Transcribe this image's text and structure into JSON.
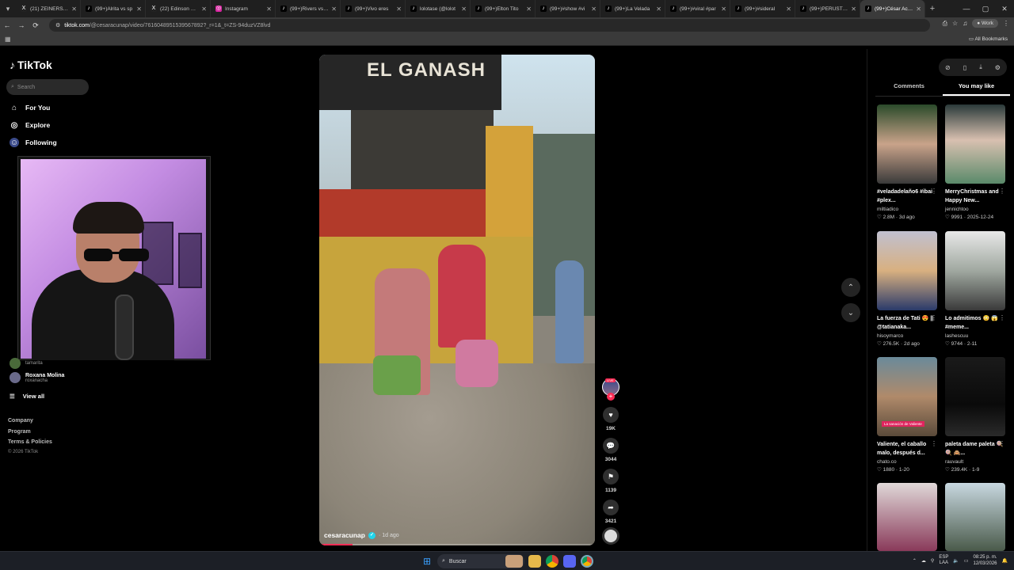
{
  "browser": {
    "tabs": [
      {
        "title": "(21) ZEINERS 😮",
        "icon": "x-icon",
        "color": "#222"
      },
      {
        "title": "(99+)Alrita vs sp",
        "icon": "tiktok-icon",
        "color": "#000"
      },
      {
        "title": "(22) Edinson Cav",
        "icon": "x-icon",
        "color": "#222"
      },
      {
        "title": "Instagram",
        "icon": "instagram-icon",
        "color": "#d6249f"
      },
      {
        "title": "(99+)Rivers vs Re",
        "icon": "tiktok-icon",
        "color": "#000"
      },
      {
        "title": "(99+)Vivo eres",
        "icon": "tiktok-icon",
        "color": "#000"
      },
      {
        "title": "lolotase (@lolot",
        "icon": "tiktok-icon",
        "color": "#000"
      },
      {
        "title": "(99+)Elton Tito",
        "icon": "tiktok-icon",
        "color": "#000"
      },
      {
        "title": "(99+)#show #vi",
        "icon": "tiktok-icon",
        "color": "#000"
      },
      {
        "title": "(99+)La Velada",
        "icon": "tiktok-icon",
        "color": "#000"
      },
      {
        "title": "(99+)#viral #par",
        "icon": "tiktok-icon",
        "color": "#000"
      },
      {
        "title": "(99+)#sideral",
        "icon": "tiktok-icon",
        "color": "#000"
      },
      {
        "title": "(99+)PERUST CO",
        "icon": "tiktok-icon",
        "color": "#000"
      },
      {
        "title": "(99+)César Acuña",
        "icon": "tiktok-icon",
        "color": "#000",
        "active": true
      }
    ],
    "url_host": "tiktok.com",
    "url_path": "/@cesaracunap/video/7616048951539567892?_r=1&_t=ZS-94duzVZ8lvd",
    "profile_label": "Work",
    "all_bookmarks": "All Bookmarks"
  },
  "sidebar": {
    "brand": "TikTok",
    "search_placeholder": "Search",
    "nav": [
      {
        "label": "For You",
        "icon": "home-icon"
      },
      {
        "label": "Explore",
        "icon": "compass-icon"
      },
      {
        "label": "Following",
        "icon": "following-icon"
      }
    ],
    "partial_label": "tamarita",
    "account": {
      "name": "Roxana Molina",
      "handle": "roxanacha"
    },
    "view_all": "View all",
    "footer": [
      "Company",
      "Program",
      "Terms & Policies"
    ],
    "copyright": "© 2026 TikTok"
  },
  "video": {
    "sign_text": "EL GANASH",
    "username": "cesaracunap",
    "time_ago": "· 1d ago",
    "progress": 0.12
  },
  "actions": {
    "live_badge": "LIVE",
    "likes": "19K",
    "comments": "3044",
    "saves": "1139",
    "shares": "3421"
  },
  "right_panel": {
    "tabs": [
      "Comments",
      "You may like"
    ],
    "active_tab": "You may like",
    "cards": [
      {
        "caption": "#veladadelaño6 #ibai #plex...",
        "author": "miltiadico",
        "likes": "2.8M",
        "date": "3d ago"
      },
      {
        "caption": "MerryChristmas and Happy New...",
        "author": "jennichtoo",
        "likes": "9991",
        "date": "2025-12-24"
      },
      {
        "caption": "La fuerza de Tati 😍 || @tatianaka...",
        "author": "hisoymarco",
        "likes": "276.5K",
        "date": "2d ago"
      },
      {
        "caption": "Lo admitimos 😳 😱 #meme...",
        "author": "lashescuu",
        "likes": "9744",
        "date": "2-11"
      },
      {
        "caption": "Valiente, el caballo malo, después d...",
        "author": "chato.co",
        "likes": "1880",
        "date": "1-20",
        "thumb_label": "La sanación de Valiente"
      },
      {
        "caption": "paleta dame paleta 🍭 🍭 🙈...",
        "author": "rauvault",
        "likes": "239.4K",
        "date": "1-9"
      }
    ]
  },
  "taskbar": {
    "search_label": "Buscar",
    "lang": "ESP",
    "lang2": "LAA",
    "time": "08:25 p. m.",
    "date": "12/03/2026"
  }
}
